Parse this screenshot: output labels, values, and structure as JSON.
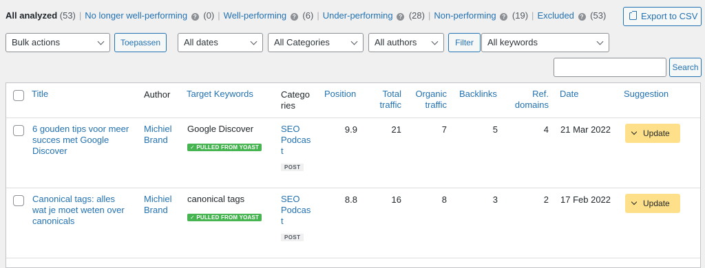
{
  "filters": [
    {
      "label": "All analyzed",
      "count": "(53)",
      "current": true,
      "help": false
    },
    {
      "label": "No longer well-performing",
      "count": "(0)",
      "current": false,
      "help": true
    },
    {
      "label": "Well-performing",
      "count": "(6)",
      "current": false,
      "help": true
    },
    {
      "label": "Under-performing",
      "count": "(28)",
      "current": false,
      "help": true
    },
    {
      "label": "Non-performing",
      "count": "(19)",
      "current": false,
      "help": true
    },
    {
      "label": "Excluded",
      "count": "(53)",
      "current": false,
      "help": true
    }
  ],
  "help_glyph": "?",
  "separator": "|",
  "export_label": "Export to CSV",
  "bulk": {
    "selected": "Bulk actions",
    "apply_label": "Toepassen"
  },
  "dates": {
    "selected": "All dates"
  },
  "categories": {
    "selected": "All Categories"
  },
  "authors": {
    "selected": "All authors"
  },
  "filter_label": "Filter",
  "keywords": {
    "selected": "All keywords"
  },
  "search": {
    "value": "",
    "button_label": "Search"
  },
  "table": {
    "headers": {
      "title": "Title",
      "author": "Author",
      "target_keywords": "Target Keywords",
      "categories_line1": "Catego",
      "categories_line2": "ries",
      "position": "Position",
      "total_traffic_line1": "Total",
      "total_traffic_line2": "traffic",
      "organic_traffic_line1": "Organic",
      "organic_traffic_line2": "traffic",
      "backlinks": "Backlinks",
      "ref_domains_line1": "Ref.",
      "ref_domains_line2": "domains",
      "date": "Date",
      "suggestion": "Suggestion"
    },
    "rows": [
      {
        "title_lines": [
          "6 gouden tips voor meer",
          "succes met Google",
          "Discover"
        ],
        "author_lines": [
          "Michiel",
          "Brand"
        ],
        "keyword": "Google Discover",
        "keyword_badge": "✓ PULLED FROM YOAST",
        "category_lines": [
          "SEO",
          "Podcas",
          "t"
        ],
        "post_type": "POST",
        "position": "9.9",
        "total_traffic": "21",
        "organic_traffic": "7",
        "backlinks": "5",
        "ref_domains": "4",
        "date": "21 Mar 2022",
        "suggestion": "Update"
      },
      {
        "title_lines": [
          "Canonical tags: alles",
          "wat je moet weten over",
          "canonicals"
        ],
        "author_lines": [
          "Michiel",
          "Brand"
        ],
        "keyword": "canonical tags",
        "keyword_badge": "✓ PULLED FROM YOAST",
        "category_lines": [
          "SEO",
          "Podcas",
          "t"
        ],
        "post_type": "POST",
        "position": "8.8",
        "total_traffic": "16",
        "organic_traffic": "8",
        "backlinks": "3",
        "ref_domains": "2",
        "date": "17 Feb 2022",
        "suggestion": "Update"
      }
    ]
  },
  "colors": {
    "link": "#2271b1",
    "badge_green": "#46b450",
    "update_yellow": "#ffe08a",
    "background": "#f0f0f1"
  }
}
